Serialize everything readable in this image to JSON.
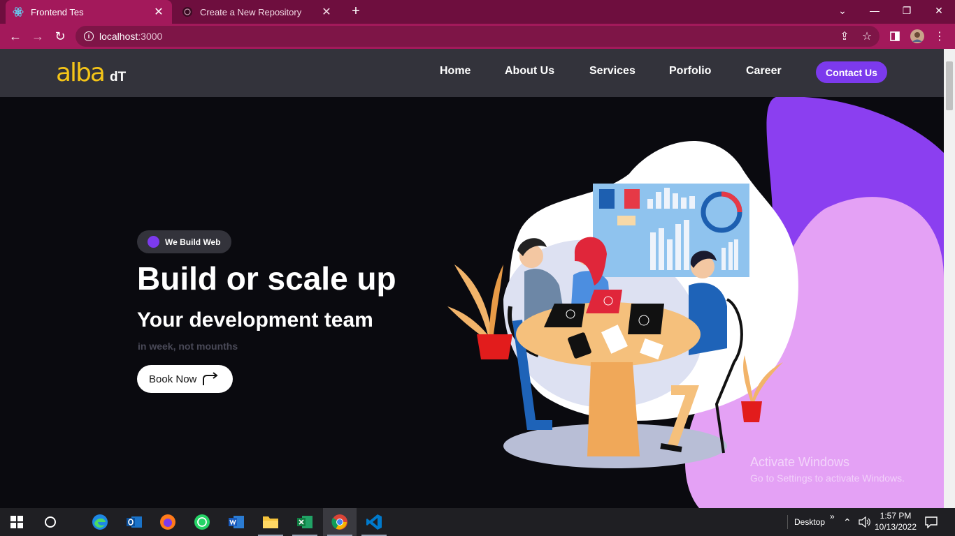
{
  "browser": {
    "tabs": [
      {
        "title": "Frontend Tes",
        "icon": "react-icon",
        "active": true
      },
      {
        "title": "Create a New Repository",
        "icon": "github-icon",
        "active": false
      }
    ],
    "address": {
      "host": "localhost",
      "port": ":3000"
    }
  },
  "site": {
    "logo": {
      "brand": "alba",
      "suffix": "dT"
    },
    "nav": [
      "Home",
      "About Us",
      "Services",
      "Porfolio",
      "Career"
    ],
    "contact_label": "Contact Us",
    "hero": {
      "badge": "We Build Web",
      "title": "Build or scale up",
      "subtitle": "Your development team",
      "tagline": "in week, not mounths",
      "cta": "Book Now"
    },
    "colors": {
      "accent": "#7c3aed",
      "logo": "#f5c518",
      "header": "#33333b",
      "blob_purple": "#8b3ff0",
      "blob_pink": "#e4a1f5"
    }
  },
  "watermark": {
    "title": "Activate Windows",
    "body": "Go to Settings to activate Windows."
  },
  "taskbar": {
    "apps": [
      "start-icon",
      "cortana-icon",
      "edge-icon",
      "outlook-icon",
      "firefox-icon",
      "whatsapp-icon",
      "word-icon",
      "file-explorer-icon",
      "excel-icon",
      "chrome-icon",
      "vscode-icon"
    ],
    "desktop_label": "Desktop",
    "chevron": "»",
    "time": "1:57 PM",
    "date": "10/13/2022"
  }
}
